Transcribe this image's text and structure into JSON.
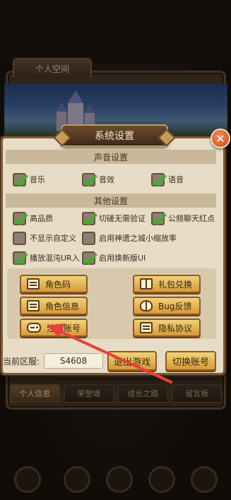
{
  "background": {
    "personal_tab": "个人空间",
    "bottom_tabs": [
      "个人信息",
      "荣誉墙",
      "成长之路",
      "留言板"
    ]
  },
  "dialog": {
    "title": "系统设置",
    "sound_section": {
      "header": "声音设置",
      "options": [
        {
          "label": "音乐",
          "checked": true
        },
        {
          "label": "音效",
          "checked": true
        },
        {
          "label": "语音",
          "checked": true
        }
      ]
    },
    "other_section": {
      "header": "其他设置",
      "options": [
        {
          "label": "高品质",
          "checked": true
        },
        {
          "label": "切磋无需验证",
          "checked": true
        },
        {
          "label": "公频聊天红点",
          "checked": true
        },
        {
          "label": "不显示自定义",
          "checked": false
        },
        {
          "label": "启用神遗之城小缩放率",
          "checked": false
        },
        {
          "label": "播放混沌UR入",
          "checked": true
        },
        {
          "label": "启用焕新版UI",
          "checked": true
        }
      ]
    },
    "buttons": {
      "role_code": "角色码",
      "gift_redeem": "礼包兑换",
      "role_info": "角色信息",
      "bug_feedback": "Bug反馈",
      "cancel_account": "注销账号",
      "privacy": "隐私协议"
    },
    "server_label": "当前区服:",
    "server_value": "S4608",
    "exit_game": "退出游戏",
    "switch_account": "切换账号"
  },
  "colors": {
    "accent": "#d69a38",
    "check": "#3fae2a",
    "arrow": "#e8403a"
  }
}
